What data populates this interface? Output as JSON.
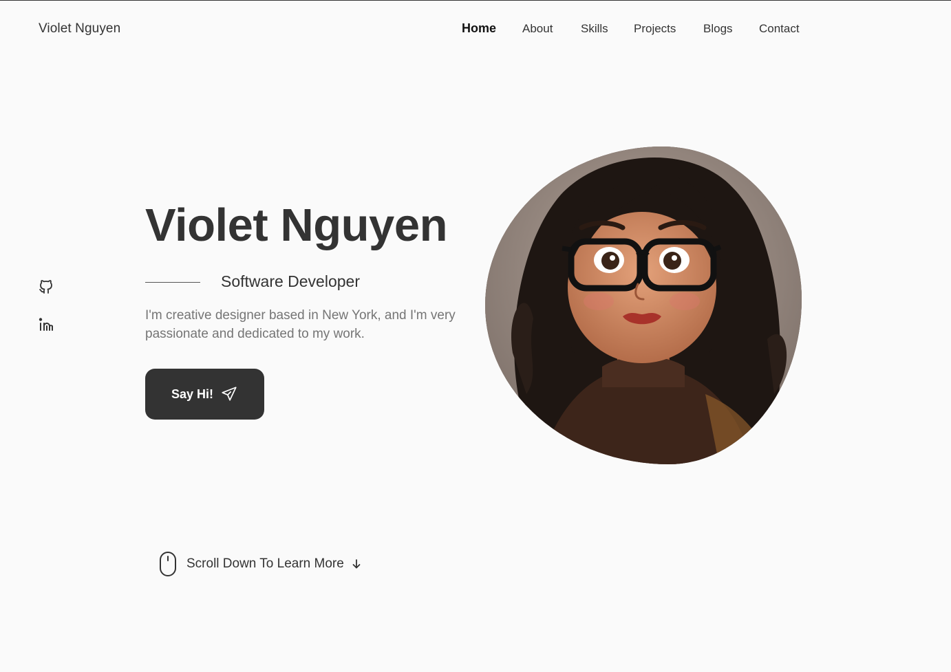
{
  "header": {
    "brand": "Violet Nguyen",
    "nav": [
      {
        "label": "Home",
        "active": true
      },
      {
        "label": "About"
      },
      {
        "label": "Skills"
      },
      {
        "label": "Projects"
      },
      {
        "label": "Blogs"
      },
      {
        "label": "Contact"
      }
    ]
  },
  "social": [
    {
      "icon": "github-icon"
    },
    {
      "icon": "linkedin-icon"
    }
  ],
  "hero": {
    "name": "Violet Nguyen",
    "role": "Software Developer",
    "description": "I'm creative designer based in New York, and I'm very passionate and dedicated to my work.",
    "cta_label": "Say Hi!",
    "cta_icon": "send-icon"
  },
  "scroll": {
    "label": "Scroll Down To Learn More",
    "mouse_icon": "mouse-icon",
    "arrow_icon": "arrow-down-icon"
  },
  "colors": {
    "background": "#fafafa",
    "text": "#333333",
    "muted": "#757575",
    "button": "#333333"
  }
}
